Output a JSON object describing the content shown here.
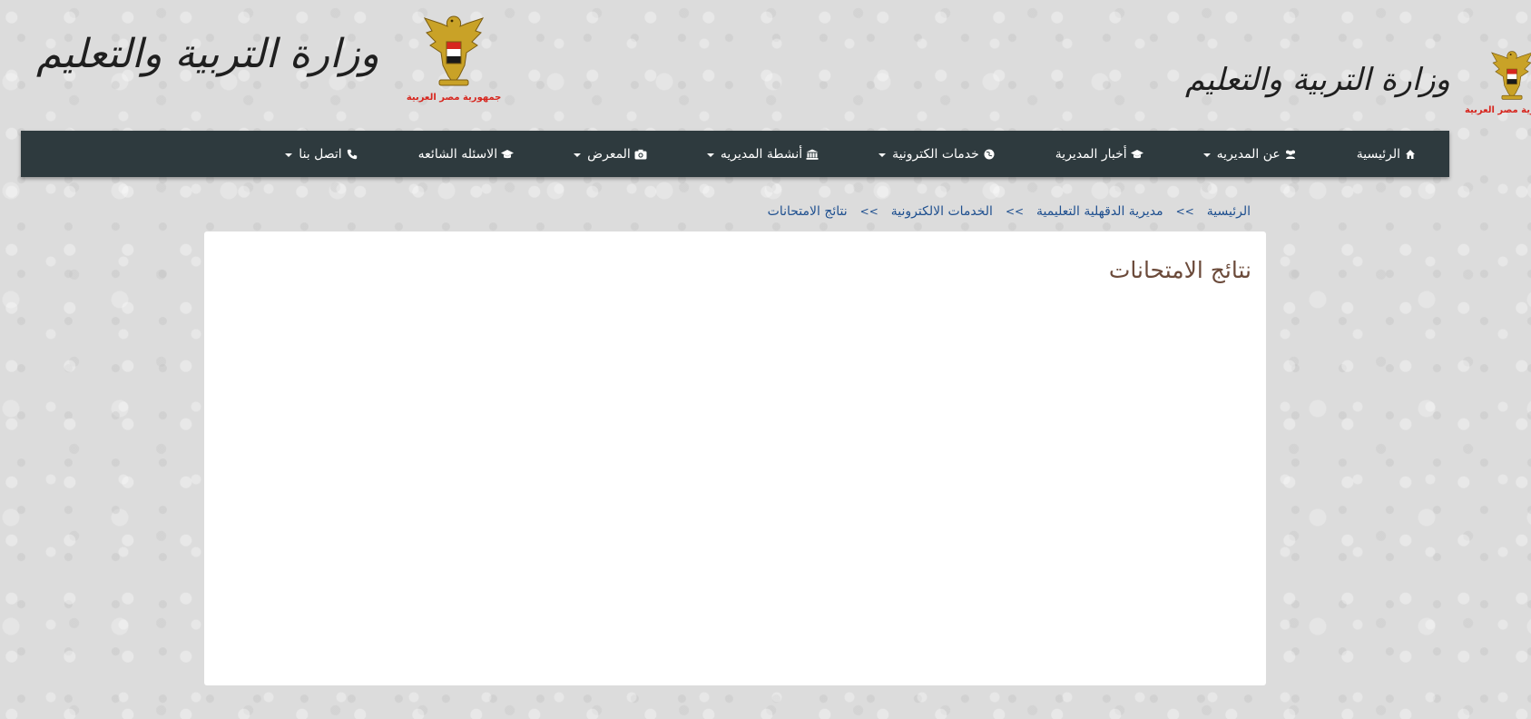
{
  "header": {
    "left_logo": {
      "calligraphy": "وزارة التربية والتعليم",
      "emblem_caption": "جمهورية مصر العربية",
      "emblem_icon": "eagle-emblem-icon"
    },
    "right_logo": {
      "calligraphy": "وزارة التربية والتعليم",
      "emblem_caption": "جمهورية مصر العربية",
      "emblem_icon": "eagle-emblem-icon"
    }
  },
  "navbar": {
    "items": [
      {
        "label": "الرئيسية",
        "icon": "home-icon",
        "dropdown": false
      },
      {
        "label": "عن المديريه",
        "icon": "users-icon",
        "dropdown": true
      },
      {
        "label": "أخبار المديرية",
        "icon": "graduation-cap-icon",
        "dropdown": false
      },
      {
        "label": "خدمات الكترونية",
        "icon": "globe-icon",
        "dropdown": true
      },
      {
        "label": "أنشطة المديريه",
        "icon": "institution-icon",
        "dropdown": true
      },
      {
        "label": "المعرض",
        "icon": "camera-icon",
        "dropdown": true
      },
      {
        "label": "الاسئله الشائعه",
        "icon": "graduation-cap-icon",
        "dropdown": false
      },
      {
        "label": "اتصل بنا",
        "icon": "phone-icon",
        "dropdown": true
      }
    ]
  },
  "breadcrumb": {
    "items": [
      "الرئيسية",
      "مديرية الدقهلية التعليمية",
      "الخدمات الالكترونية",
      "نتائج الامتحانات"
    ],
    "separator": ">>"
  },
  "content": {
    "title": "نتائج الامتحانات"
  },
  "colors": {
    "navbar_bg": "#2e3a3e",
    "link": "#1e4f8f",
    "title": "#6b4a3a",
    "emblem_caption": "#d7261e",
    "emblem_gold": "#c9a227"
  }
}
